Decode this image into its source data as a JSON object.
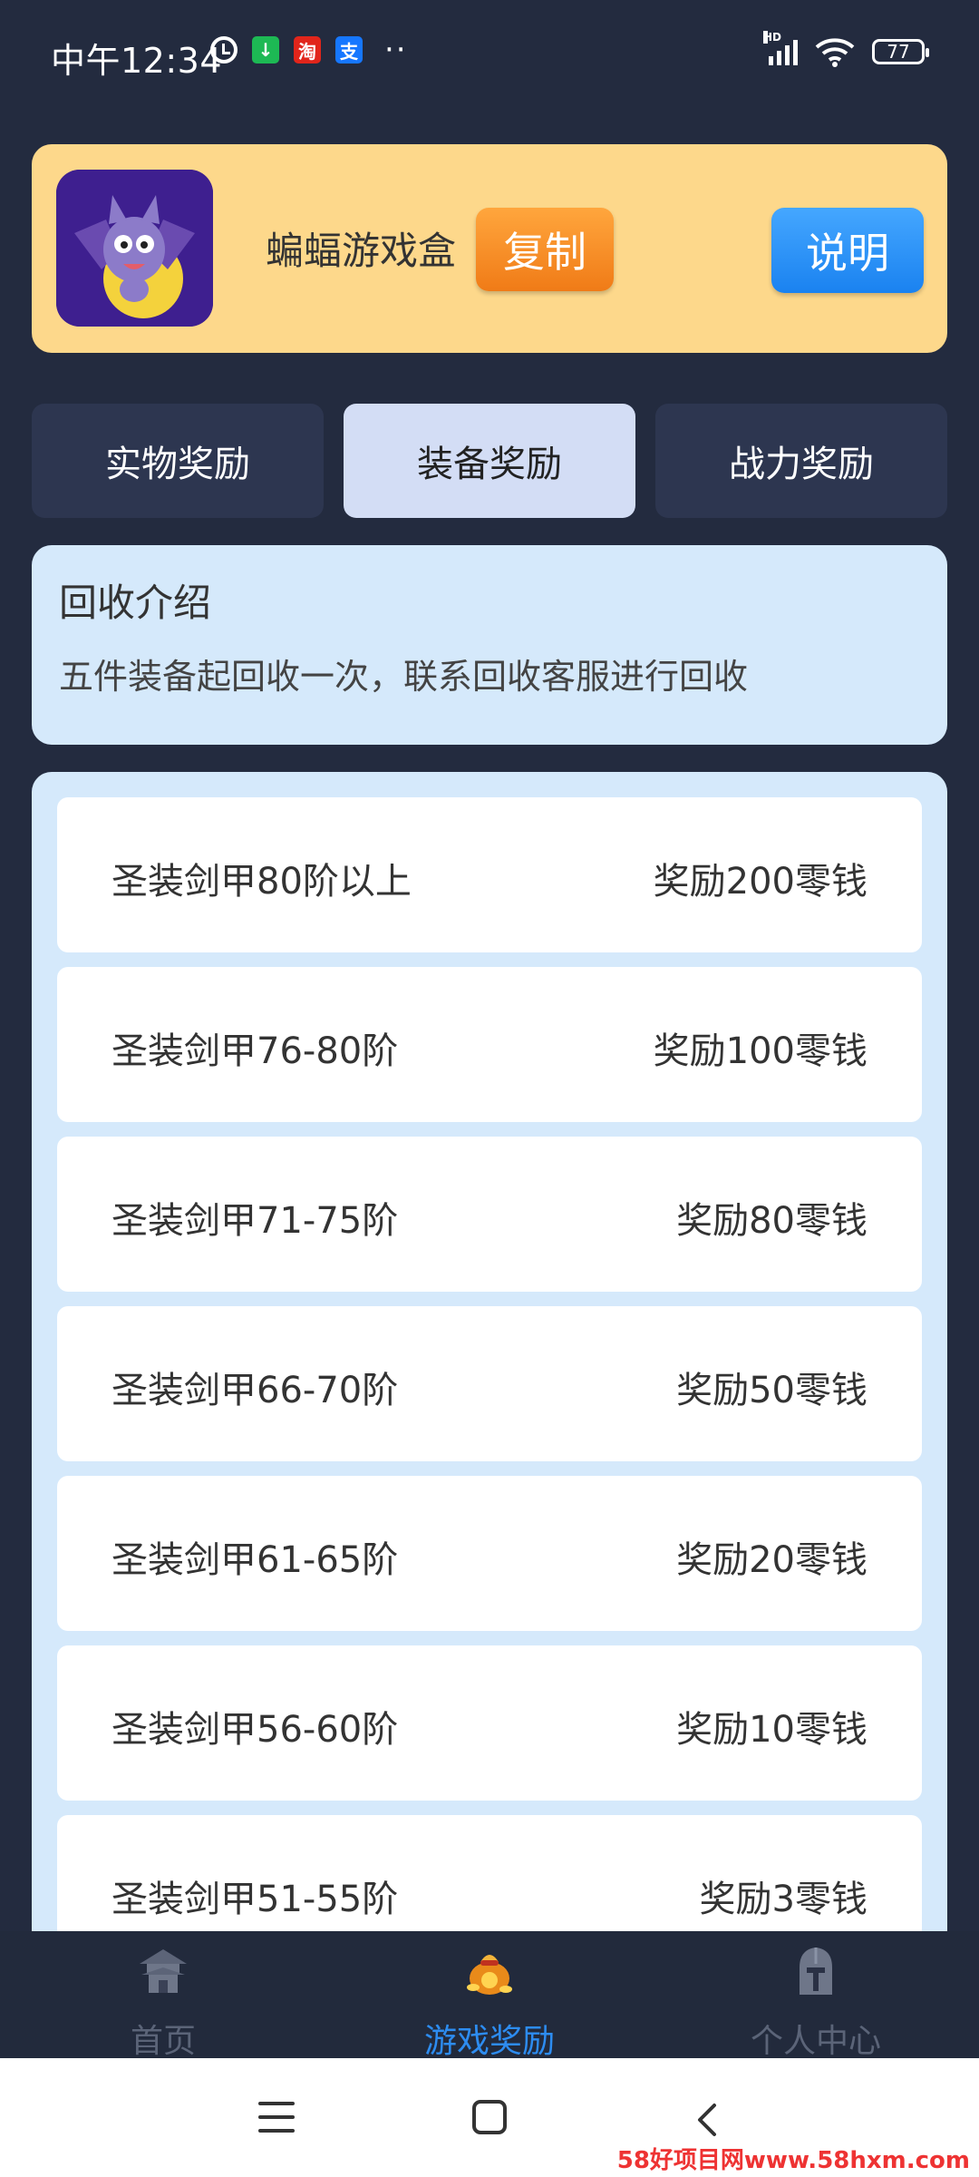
{
  "status_bar": {
    "time": "中午12:34",
    "badges": [
      {
        "icon": "download-icon",
        "text": "↓",
        "color": "#1db954"
      },
      {
        "icon": "taobao-icon",
        "text": "淘",
        "color": "#e1251b"
      },
      {
        "icon": "alipay-icon",
        "text": "支",
        "color": "#1677ff"
      }
    ],
    "more": "··",
    "signal_label": "HD",
    "battery": "77"
  },
  "header": {
    "app_name": "蝙蝠游戏盒",
    "copy_label": "复制",
    "help_label": "说明"
  },
  "tabs": [
    {
      "label": "实物奖励",
      "active": false
    },
    {
      "label": "装备奖励",
      "active": true
    },
    {
      "label": "战力奖励",
      "active": false
    }
  ],
  "intro": {
    "title": "回收介绍",
    "text": "五件装备起回收一次，联系回收客服进行回收"
  },
  "rewards": [
    {
      "name": "圣装剑甲80阶以上",
      "value": "奖励200零钱"
    },
    {
      "name": "圣装剑甲76-80阶",
      "value": "奖励100零钱"
    },
    {
      "name": "圣装剑甲71-75阶",
      "value": "奖励80零钱"
    },
    {
      "name": "圣装剑甲66-70阶",
      "value": "奖励50零钱"
    },
    {
      "name": "圣装剑甲61-65阶",
      "value": "奖励20零钱"
    },
    {
      "name": "圣装剑甲56-60阶",
      "value": "奖励10零钱"
    },
    {
      "name": "圣装剑甲51-55阶",
      "value": "奖励3零钱"
    }
  ],
  "bottom_nav": [
    {
      "label": "首页",
      "icon": "pagoda-icon",
      "active": false
    },
    {
      "label": "游戏奖励",
      "icon": "money-bag-icon",
      "active": true
    },
    {
      "label": "个人中心",
      "icon": "helmet-icon",
      "active": false
    }
  ],
  "watermark": "58好项目网www.58hxm.com",
  "colors": {
    "background": "#232b3f",
    "header_card": "#fdd88b",
    "copy_button": "#f07b17",
    "help_button": "#1a82f0",
    "active_tab": "#d3ddf5",
    "active_nav": "#2d8cf0"
  }
}
